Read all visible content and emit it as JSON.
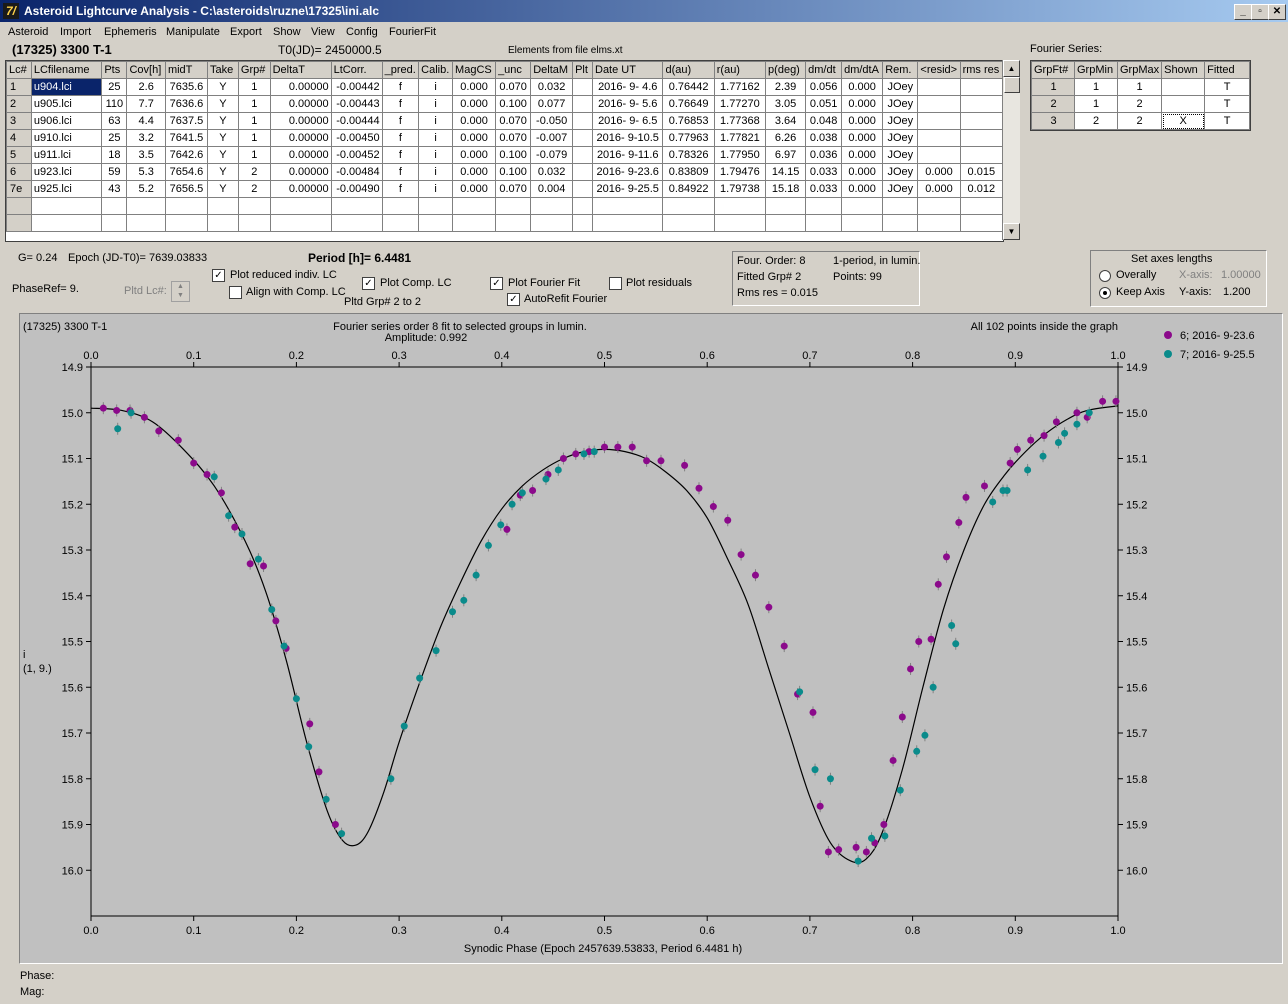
{
  "window": {
    "title": "Asteroid Lightcurve Analysis - C:\\asteroids\\ruzne\\17325\\ini.alc",
    "icon_glyph": "7/",
    "min_glyph": "_",
    "max_glyph": "▫",
    "close_glyph": "✕"
  },
  "menu": [
    "Asteroid",
    "Import",
    "Ephemeris",
    "Manipulate",
    "Export",
    "Show",
    "View",
    "Config",
    "FourierFit"
  ],
  "header": {
    "object": "(17325) 3300 T-1",
    "t0": "T0(JD)= 2450000.5",
    "elements": "Elements from file elms.xt"
  },
  "lc_table": {
    "columns": [
      "Lc#",
      "LCfilename",
      "Pts",
      "Cov[h]",
      "midT",
      "Take",
      "Grp#",
      "DeltaT",
      "LtCorr.",
      "_pred.",
      "Calib.",
      "MagCS",
      "_unc",
      "DeltaM",
      "Plt",
      "Date UT",
      "d(au)",
      "r(au)",
      "p(deg)",
      "dm/dt",
      "dm/dtA",
      "Rem.",
      "<resid>",
      "rms res"
    ],
    "rows": [
      [
        "1",
        "u904.lci",
        "25",
        "2.6",
        "7635.6",
        "Y",
        "1",
        "0.00000",
        "-0.00442",
        "f",
        "i",
        "0.000",
        "0.070",
        "0.032",
        "",
        "2016- 9- 4.6",
        "0.76442",
        "1.77162",
        "2.39",
        "0.056",
        "0.000",
        "JOey",
        "",
        ""
      ],
      [
        "2",
        "u905.lci",
        "110",
        "7.7",
        "7636.6",
        "Y",
        "1",
        "0.00000",
        "-0.00443",
        "f",
        "i",
        "0.000",
        "0.100",
        "0.077",
        "",
        "2016- 9- 5.6",
        "0.76649",
        "1.77270",
        "3.05",
        "0.051",
        "0.000",
        "JOey",
        "",
        ""
      ],
      [
        "3",
        "u906.lci",
        "63",
        "4.4",
        "7637.5",
        "Y",
        "1",
        "0.00000",
        "-0.00444",
        "f",
        "i",
        "0.000",
        "0.070",
        "-0.050",
        "",
        "2016- 9- 6.5",
        "0.76853",
        "1.77368",
        "3.64",
        "0.048",
        "0.000",
        "JOey",
        "",
        ""
      ],
      [
        "4",
        "u910.lci",
        "25",
        "3.2",
        "7641.5",
        "Y",
        "1",
        "0.00000",
        "-0.00450",
        "f",
        "i",
        "0.000",
        "0.070",
        "-0.007",
        "",
        "2016- 9-10.5",
        "0.77963",
        "1.77821",
        "6.26",
        "0.038",
        "0.000",
        "JOey",
        "",
        ""
      ],
      [
        "5",
        "u911.lci",
        "18",
        "3.5",
        "7642.6",
        "Y",
        "1",
        "0.00000",
        "-0.00452",
        "f",
        "i",
        "0.000",
        "0.100",
        "-0.079",
        "",
        "2016- 9-11.6",
        "0.78326",
        "1.77950",
        "6.97",
        "0.036",
        "0.000",
        "JOey",
        "",
        ""
      ],
      [
        "6",
        "u923.lci",
        "59",
        "5.3",
        "7654.6",
        "Y",
        "2",
        "0.00000",
        "-0.00484",
        "f",
        "i",
        "0.000",
        "0.100",
        "0.032",
        "",
        "2016- 9-23.6",
        "0.83809",
        "1.79476",
        "14.15",
        "0.033",
        "0.000",
        "JOey",
        "0.000",
        "0.015"
      ],
      [
        "7e",
        "u925.lci",
        "43",
        "5.2",
        "7656.5",
        "Y",
        "2",
        "0.00000",
        "-0.00490",
        "f",
        "i",
        "0.000",
        "0.070",
        "0.004",
        "",
        "2016- 9-25.5",
        "0.84922",
        "1.79738",
        "15.18",
        "0.033",
        "0.000",
        "JOey",
        "0.000",
        "0.012"
      ]
    ],
    "empty_rows": 2,
    "selected_cell": "u904.lci"
  },
  "fourier_series": {
    "title": "Fourier Series:",
    "columns": [
      "GrpFt#",
      "GrpMin",
      "GrpMax",
      "Shown",
      "Fitted"
    ],
    "rows": [
      [
        "1",
        "1",
        "1",
        "",
        "T"
      ],
      [
        "2",
        "1",
        "2",
        "",
        "T"
      ],
      [
        "3",
        "2",
        "2",
        "X",
        "T"
      ]
    ]
  },
  "controls": {
    "g_value": "G= 0.24",
    "epoch": "Epoch (JD-T0)= 7639.03833",
    "period": "Period [h]= 6.4481",
    "phase_ref": "PhaseRef= 9.",
    "pltd_lc": "Pltd Lc#:",
    "plot_reduced": "Plot reduced indiv. LC",
    "align_comp": "Align with Comp. LC",
    "plot_comp": "Plot Comp. LC",
    "pltd_grp": "Pltd Grp#  2   to   2",
    "plot_fourier": "Plot Fourier Fit",
    "autorefit": "AutoRefit Fourier",
    "plot_residuals": "Plot residuals",
    "checked": {
      "plot_reduced": true,
      "align_comp": false,
      "plot_comp": true,
      "plot_fourier": true,
      "autorefit": true,
      "plot_residuals": false
    }
  },
  "fit_info": {
    "order": "Four. Order:  8",
    "fitted_grp": "Fitted Grp# 2",
    "rms": "Rms res     = 0.015",
    "mode": "1-period, in lumin.",
    "points": "Points: 99"
  },
  "axes_box": {
    "title": "Set axes lengths",
    "overall": "Overally",
    "keep": "Keep Axis",
    "xaxis_label": "X-axis:",
    "xaxis_value": "1.00000",
    "yaxis_label": "Y-axis:",
    "yaxis_value": "1.200",
    "selected": "keep"
  },
  "chart_data": {
    "type": "scatter",
    "title_left": "(17325) 3300 T-1",
    "title": "Fourier series order 8 fit to selected groups in lumin.",
    "subtitle": "Amplitude: 0.992",
    "note_right": "All 102 points inside the graph",
    "xlabel": "Synodic Phase (Epoch 2457639.53833, Period 6.4481 h)",
    "ylabel_top": "i",
    "ylabel_bottom": "(1, 9.)",
    "xlim": [
      0.0,
      1.0
    ],
    "ylim": [
      16.1,
      14.9
    ],
    "x_ticks": [
      "0.0",
      "0.1",
      "0.2",
      "0.3",
      "0.4",
      "0.5",
      "0.6",
      "0.7",
      "0.8",
      "0.9",
      "1.0"
    ],
    "y_ticks": [
      "14.9",
      "15.0",
      "15.1",
      "15.2",
      "15.3",
      "15.4",
      "15.5",
      "15.6",
      "15.7",
      "15.8",
      "15.9",
      "16.0"
    ],
    "legend_position": "top-right outside",
    "colors": {
      "g6": "#8b0a8b",
      "g7": "#0a8b8b",
      "fit": "#000000"
    },
    "series": [
      {
        "name": "6; 2016- 9-23.6",
        "color": "#8b0a8b",
        "x": [
          0.012,
          0.025,
          0.038,
          0.052,
          0.066,
          0.085,
          0.1,
          0.113,
          0.127,
          0.14,
          0.155,
          0.168,
          0.18,
          0.19,
          0.213,
          0.222,
          0.238,
          0.405,
          0.418,
          0.43,
          0.445,
          0.46,
          0.472,
          0.485,
          0.5,
          0.513,
          0.527,
          0.541,
          0.555,
          0.578,
          0.592,
          0.606,
          0.62,
          0.633,
          0.647,
          0.66,
          0.675,
          0.688,
          0.703,
          0.71,
          0.718,
          0.728,
          0.745,
          0.755,
          0.763,
          0.772,
          0.781,
          0.79,
          0.798,
          0.806,
          0.818,
          0.825,
          0.833,
          0.845,
          0.852,
          0.87,
          0.895,
          0.902,
          0.915,
          0.928,
          0.94,
          0.96,
          0.97,
          0.985,
          0.998
        ],
        "y": [
          14.99,
          14.995,
          14.995,
          15.01,
          15.04,
          15.06,
          15.11,
          15.135,
          15.175,
          15.25,
          15.33,
          15.335,
          15.455,
          15.515,
          15.68,
          15.785,
          15.9,
          15.255,
          15.18,
          15.17,
          15.135,
          15.1,
          15.09,
          15.085,
          15.075,
          15.075,
          15.075,
          15.105,
          15.105,
          15.115,
          15.165,
          15.205,
          15.235,
          15.31,
          15.355,
          15.425,
          15.51,
          15.615,
          15.655,
          15.86,
          15.96,
          15.955,
          15.95,
          15.96,
          15.94,
          15.9,
          15.76,
          15.665,
          15.56,
          15.5,
          15.495,
          15.375,
          15.315,
          15.24,
          15.185,
          15.16,
          15.11,
          15.08,
          15.06,
          15.05,
          15.02,
          15.0,
          15.01,
          14.975,
          14.975
        ]
      },
      {
        "name": "7; 2016- 9-25.5",
        "color": "#0a8b8b",
        "x": [
          0.026,
          0.039,
          0.12,
          0.134,
          0.147,
          0.163,
          0.176,
          0.188,
          0.2,
          0.212,
          0.229,
          0.244,
          0.292,
          0.305,
          0.32,
          0.336,
          0.352,
          0.363,
          0.375,
          0.387,
          0.399,
          0.41,
          0.42,
          0.443,
          0.455,
          0.48,
          0.49,
          0.69,
          0.705,
          0.72,
          0.747,
          0.76,
          0.773,
          0.788,
          0.804,
          0.812,
          0.82,
          0.838,
          0.842,
          0.878,
          0.888,
          0.892,
          0.912,
          0.927,
          0.942,
          0.948,
          0.96,
          0.972
        ],
        "y": [
          15.035,
          15.0,
          15.14,
          15.225,
          15.265,
          15.32,
          15.43,
          15.51,
          15.625,
          15.73,
          15.845,
          15.92,
          15.8,
          15.685,
          15.58,
          15.52,
          15.435,
          15.41,
          15.355,
          15.29,
          15.245,
          15.2,
          15.175,
          15.145,
          15.125,
          15.09,
          15.085,
          15.61,
          15.78,
          15.8,
          15.98,
          15.93,
          15.925,
          15.825,
          15.74,
          15.705,
          15.6,
          15.465,
          15.505,
          15.195,
          15.17,
          15.17,
          15.125,
          15.095,
          15.065,
          15.045,
          15.025,
          15.0
        ]
      }
    ],
    "fit_curve": {
      "x": [
        0.0,
        0.03,
        0.06,
        0.09,
        0.12,
        0.15,
        0.17,
        0.19,
        0.21,
        0.23,
        0.245,
        0.258,
        0.27,
        0.285,
        0.3,
        0.32,
        0.34,
        0.36,
        0.38,
        0.4,
        0.42,
        0.44,
        0.46,
        0.48,
        0.5,
        0.52,
        0.54,
        0.56,
        0.58,
        0.6,
        0.62,
        0.64,
        0.66,
        0.68,
        0.7,
        0.72,
        0.74,
        0.755,
        0.77,
        0.79,
        0.81,
        0.83,
        0.85,
        0.87,
        0.89,
        0.91,
        0.93,
        0.95,
        0.97,
        1.0
      ],
      "y": [
        14.99,
        14.995,
        15.02,
        15.08,
        15.16,
        15.28,
        15.39,
        15.54,
        15.72,
        15.87,
        15.935,
        15.945,
        15.915,
        15.83,
        15.72,
        15.59,
        15.47,
        15.37,
        15.28,
        15.21,
        15.16,
        15.125,
        15.1,
        15.085,
        15.08,
        15.085,
        15.1,
        15.13,
        15.17,
        15.23,
        15.32,
        15.42,
        15.56,
        15.7,
        15.84,
        15.94,
        15.98,
        15.975,
        15.92,
        15.78,
        15.6,
        15.43,
        15.3,
        15.2,
        15.135,
        15.085,
        15.045,
        15.015,
        14.995,
        14.985
      ]
    }
  },
  "status": {
    "phase": "Phase:",
    "mag": "Mag:"
  }
}
